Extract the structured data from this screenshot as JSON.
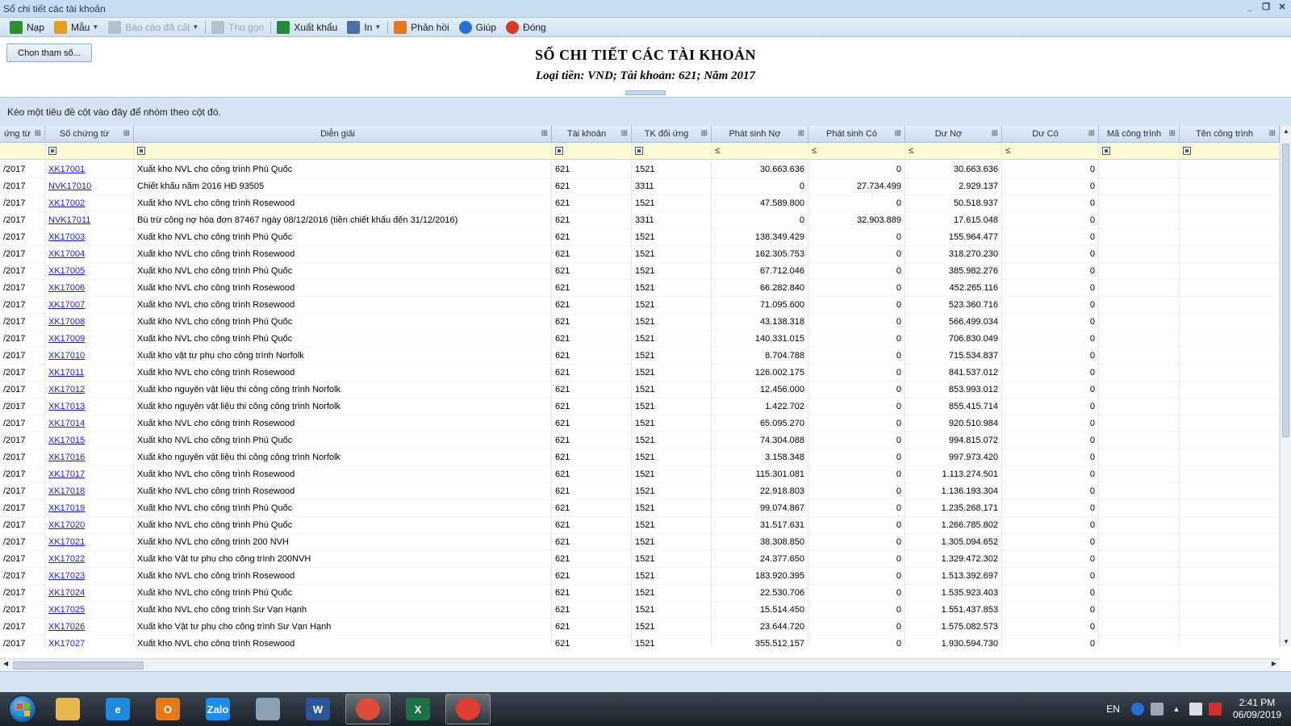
{
  "window": {
    "title": "Sổ chi tiết các tài khoản",
    "min": "_",
    "restore": "❐",
    "close": "✕"
  },
  "toolbar": {
    "items": [
      {
        "label": "Nạp",
        "icon": "refresh-icon",
        "color": "#2f8f2f"
      },
      {
        "label": "Mẫu",
        "icon": "template-icon",
        "color": "#e0a020"
      },
      {
        "label": "Báo cáo đã cất",
        "icon": "save-icon",
        "color": "#9aa6b4"
      },
      {
        "label": "Thu gọn",
        "icon": "collapse-icon",
        "color": "#9aa6b4"
      },
      {
        "label": "Xuất khẩu",
        "icon": "excel-export-icon",
        "color": "#1f8a3a"
      },
      {
        "label": "In",
        "icon": "print-icon",
        "color": "#4a6fa5"
      },
      {
        "label": "Phản hồi",
        "icon": "feedback-icon",
        "color": "#e8761a"
      },
      {
        "label": "Giúp",
        "icon": "help-icon",
        "color": "#2a6fd6"
      },
      {
        "label": "Đóng",
        "icon": "close-icon",
        "color": "#d83a22"
      }
    ]
  },
  "header": {
    "param_button": "Chọn tham số...",
    "title": "SỔ CHI TIẾT CÁC TÀI KHOẢN",
    "subtitle": "Loại tiền: VND; Tài khoản: 621; Năm 2017"
  },
  "group_panel": "Kéo một tiêu đề cột vào đây để nhóm theo cột đó.",
  "grid": {
    "columns": [
      "ứng từ",
      "Số chứng từ",
      "Diễn giải",
      "Tài khoản",
      "TK đối ứng",
      "Phát sinh Nợ",
      "Phát sinh Có",
      "Dư Nợ",
      "Dư Có",
      "Mã công trình",
      "Tên công trình"
    ],
    "filter_le": "≤",
    "rows": [
      [
        "/2017",
        "XK17001",
        "Xuất kho NVL cho công trình  Phú Quốc",
        "621",
        "1521",
        "30.663.636",
        "0",
        "30.663.636",
        "0"
      ],
      [
        "/2017",
        "NVK17010",
        "Chiết khấu năm 2016 HĐ 93505",
        "621",
        "3311",
        "0",
        "27.734.499",
        "2.929.137",
        "0"
      ],
      [
        "/2017",
        "XK17002",
        "Xuất kho NVL cho công trình  Rosewood",
        "621",
        "1521",
        "47.589.800",
        "0",
        "50.518.937",
        "0"
      ],
      [
        "/2017",
        "NVK17011",
        "Bù trừ công nợ hóa đơn 87467 ngày 08/12/2016 (tiền chiết khấu đến 31/12/2016)",
        "621",
        "3311",
        "0",
        "32.903.889",
        "17.615.048",
        "0"
      ],
      [
        "/2017",
        "XK17003",
        "Xuất kho NVL cho công trình  Phú Quốc",
        "621",
        "1521",
        "138.349.429",
        "0",
        "155.964.477",
        "0"
      ],
      [
        "/2017",
        "XK17004",
        "Xuất kho NVL cho công trình  Rosewood",
        "621",
        "1521",
        "162.305.753",
        "0",
        "318.270.230",
        "0"
      ],
      [
        "/2017",
        "XK17005",
        "Xuất kho NVL cho công trình  Phú Quốc",
        "621",
        "1521",
        "67.712.046",
        "0",
        "385.982.276",
        "0"
      ],
      [
        "/2017",
        "XK17006",
        "Xuất kho NVL cho công trình  Rosewood",
        "621",
        "1521",
        "66.282.840",
        "0",
        "452.265.116",
        "0"
      ],
      [
        "/2017",
        "XK17007",
        "Xuất kho NVL cho công trình  Rosewood",
        "621",
        "1521",
        "71.095.600",
        "0",
        "523.360.716",
        "0"
      ],
      [
        "/2017",
        "XK17008",
        "Xuất kho NVL cho công trình  Phú Quốc",
        "621",
        "1521",
        "43.138.318",
        "0",
        "566.499.034",
        "0"
      ],
      [
        "/2017",
        "XK17009",
        "Xuất kho NVL cho công trình  Phú Quốc",
        "621",
        "1521",
        "140.331.015",
        "0",
        "706.830.049",
        "0"
      ],
      [
        "/2017",
        "XK17010",
        "Xuất kho vật tư phụ cho công trình Norfolk",
        "621",
        "1521",
        "8.704.788",
        "0",
        "715.534.837",
        "0"
      ],
      [
        "/2017",
        "XK17011",
        "Xuất kho NVL cho công trình  Rosewood",
        "621",
        "1521",
        "126.002.175",
        "0",
        "841.537.012",
        "0"
      ],
      [
        "/2017",
        "XK17012",
        "Xuất kho nguyên vật liệu thi công công trình Norfolk",
        "621",
        "1521",
        "12.456.000",
        "0",
        "853.993.012",
        "0"
      ],
      [
        "/2017",
        "XK17013",
        "Xuất kho nguyên vật liệu thi công công trình Norfolk",
        "621",
        "1521",
        "1.422.702",
        "0",
        "855.415.714",
        "0"
      ],
      [
        "/2017",
        "XK17014",
        "Xuất kho NVL cho công trình  Rosewood",
        "621",
        "1521",
        "65.095.270",
        "0",
        "920.510.984",
        "0"
      ],
      [
        "/2017",
        "XK17015",
        "Xuất kho NVL cho công trình  Phú Quốc",
        "621",
        "1521",
        "74.304.088",
        "0",
        "994.815.072",
        "0"
      ],
      [
        "/2017",
        "XK17016",
        "Xuất kho nguyên vật liệu thi công công trình Norfolk",
        "621",
        "1521",
        "3.158.348",
        "0",
        "997.973.420",
        "0"
      ],
      [
        "/2017",
        "XK17017",
        "Xuất kho NVL cho công trình Rosewood",
        "621",
        "1521",
        "115.301.081",
        "0",
        "1.113.274.501",
        "0"
      ],
      [
        "/2017",
        "XK17018",
        "Xuất kho NVL cho công trình  Rosewood",
        "621",
        "1521",
        "22.918.803",
        "0",
        "1.136.193.304",
        "0"
      ],
      [
        "/2017",
        "XK17019",
        "Xuất kho NVL cho công trình  Phú Quốc",
        "621",
        "1521",
        "99.074.867",
        "0",
        "1.235.268.171",
        "0"
      ],
      [
        "/2017",
        "XK17020",
        "Xuất kho NVL cho công trình  Phú Quốc",
        "621",
        "1521",
        "31.517.631",
        "0",
        "1.266.785.802",
        "0"
      ],
      [
        "/2017",
        "XK17021",
        "Xuất kho NVL cho công trình 200 NVH",
        "621",
        "1521",
        "38.308.850",
        "0",
        "1.305.094.652",
        "0"
      ],
      [
        "/2017",
        "XK17022",
        "Xuất kho Vật tư phụ cho công trình  200NVH",
        "621",
        "1521",
        "24.377.650",
        "0",
        "1.329.472.302",
        "0"
      ],
      [
        "/2017",
        "XK17023",
        "Xuất kho NVL cho công trình  Rosewood",
        "621",
        "1521",
        "183.920.395",
        "0",
        "1.513.392.697",
        "0"
      ],
      [
        "/2017",
        "XK17024",
        "Xuất kho NVL cho công trình  Phú Quốc",
        "621",
        "1521",
        "22.530.706",
        "0",
        "1.535.923.403",
        "0"
      ],
      [
        "/2017",
        "XK17025",
        "Xuất kho NVL cho công trình  Sư Vạn Hạnh",
        "621",
        "1521",
        "15.514.450",
        "0",
        "1.551.437.853",
        "0"
      ],
      [
        "/2017",
        "XK17026",
        "Xuất kho Vật tư phụ cho công trình  Sư Vạn Hạnh",
        "621",
        "1521",
        "23.644.720",
        "0",
        "1.575.082.573",
        "0"
      ],
      [
        "/2017",
        "XK17027",
        "Xuất kho NVL cho công trình  Rosewood",
        "621",
        "1521",
        "355.512.157",
        "0",
        "1.930.594.730",
        "0"
      ]
    ]
  },
  "taskbar": {
    "apps": [
      {
        "name": "explorer-icon",
        "label": "",
        "color": "#e8b84a"
      },
      {
        "name": "internet-explorer-icon",
        "label": "e",
        "color": "#1a8be0"
      },
      {
        "name": "outlook-icon",
        "label": "O",
        "color": "#e8791a"
      },
      {
        "name": "zalo-icon",
        "label": "Zalo",
        "color": "#1d8cf0"
      },
      {
        "name": "network-icon",
        "label": "",
        "color": "#8aa0b5"
      },
      {
        "name": "word-icon",
        "label": "W",
        "color": "#2b5797"
      },
      {
        "name": "chrome-icon",
        "label": "",
        "color": "#dd4b39"
      },
      {
        "name": "excel-icon",
        "label": "X",
        "color": "#1e7145"
      },
      {
        "name": "misa-icon",
        "label": "",
        "color": "#e23c2f"
      }
    ],
    "lang": "EN",
    "time": "2:41 PM",
    "date": "06/09/2019"
  }
}
